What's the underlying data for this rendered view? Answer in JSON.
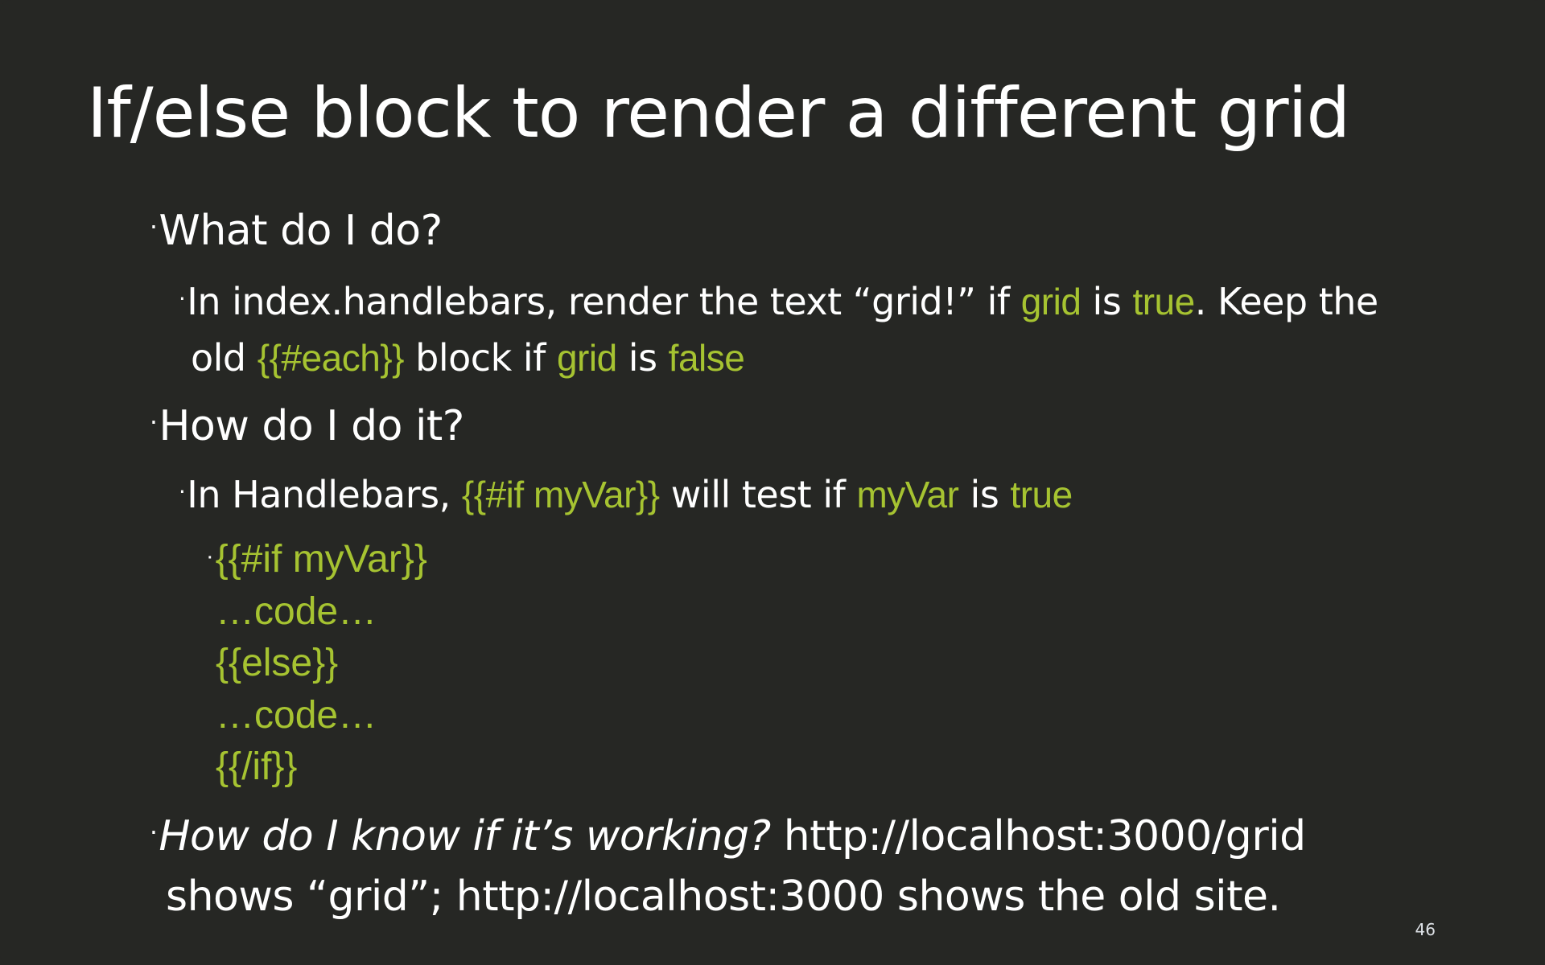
{
  "slide": {
    "title": "If/else block to render a different grid",
    "bullet_symbol": "·",
    "q1": {
      "text": "What do I do?"
    },
    "q1_sub": {
      "part1": "In index.handlebars, render the text “grid!” if ",
      "code1": "grid",
      "part2": " is ",
      "code2": "true",
      "part3": ". Keep the",
      "part4": "old ",
      "code3": "{{#each}}",
      "part5": " block if ",
      "code4": "grid",
      "part6": " is ",
      "code5": "false"
    },
    "q2": {
      "text": "How do I do it?"
    },
    "q2_sub": {
      "part1": "In Handlebars, ",
      "code1": "{{#if myVar}}",
      "part2": " will test if ",
      "code2": "myVar",
      "part3": " is ",
      "code3": "true"
    },
    "code_block": [
      "{{#if myVar}}",
      "…code…",
      "{{else}}",
      "…code…",
      "{{/if}}"
    ],
    "q3": {
      "italic": "How do I know if it’s working?",
      "rest1": " http://localhost:3000/grid",
      "rest2": "shows “grid”; http://localhost:3000 shows the old site."
    },
    "page_number": "46"
  },
  "colors": {
    "background": "#262724",
    "text": "#ffffff",
    "code_accent": "#a6c331"
  }
}
